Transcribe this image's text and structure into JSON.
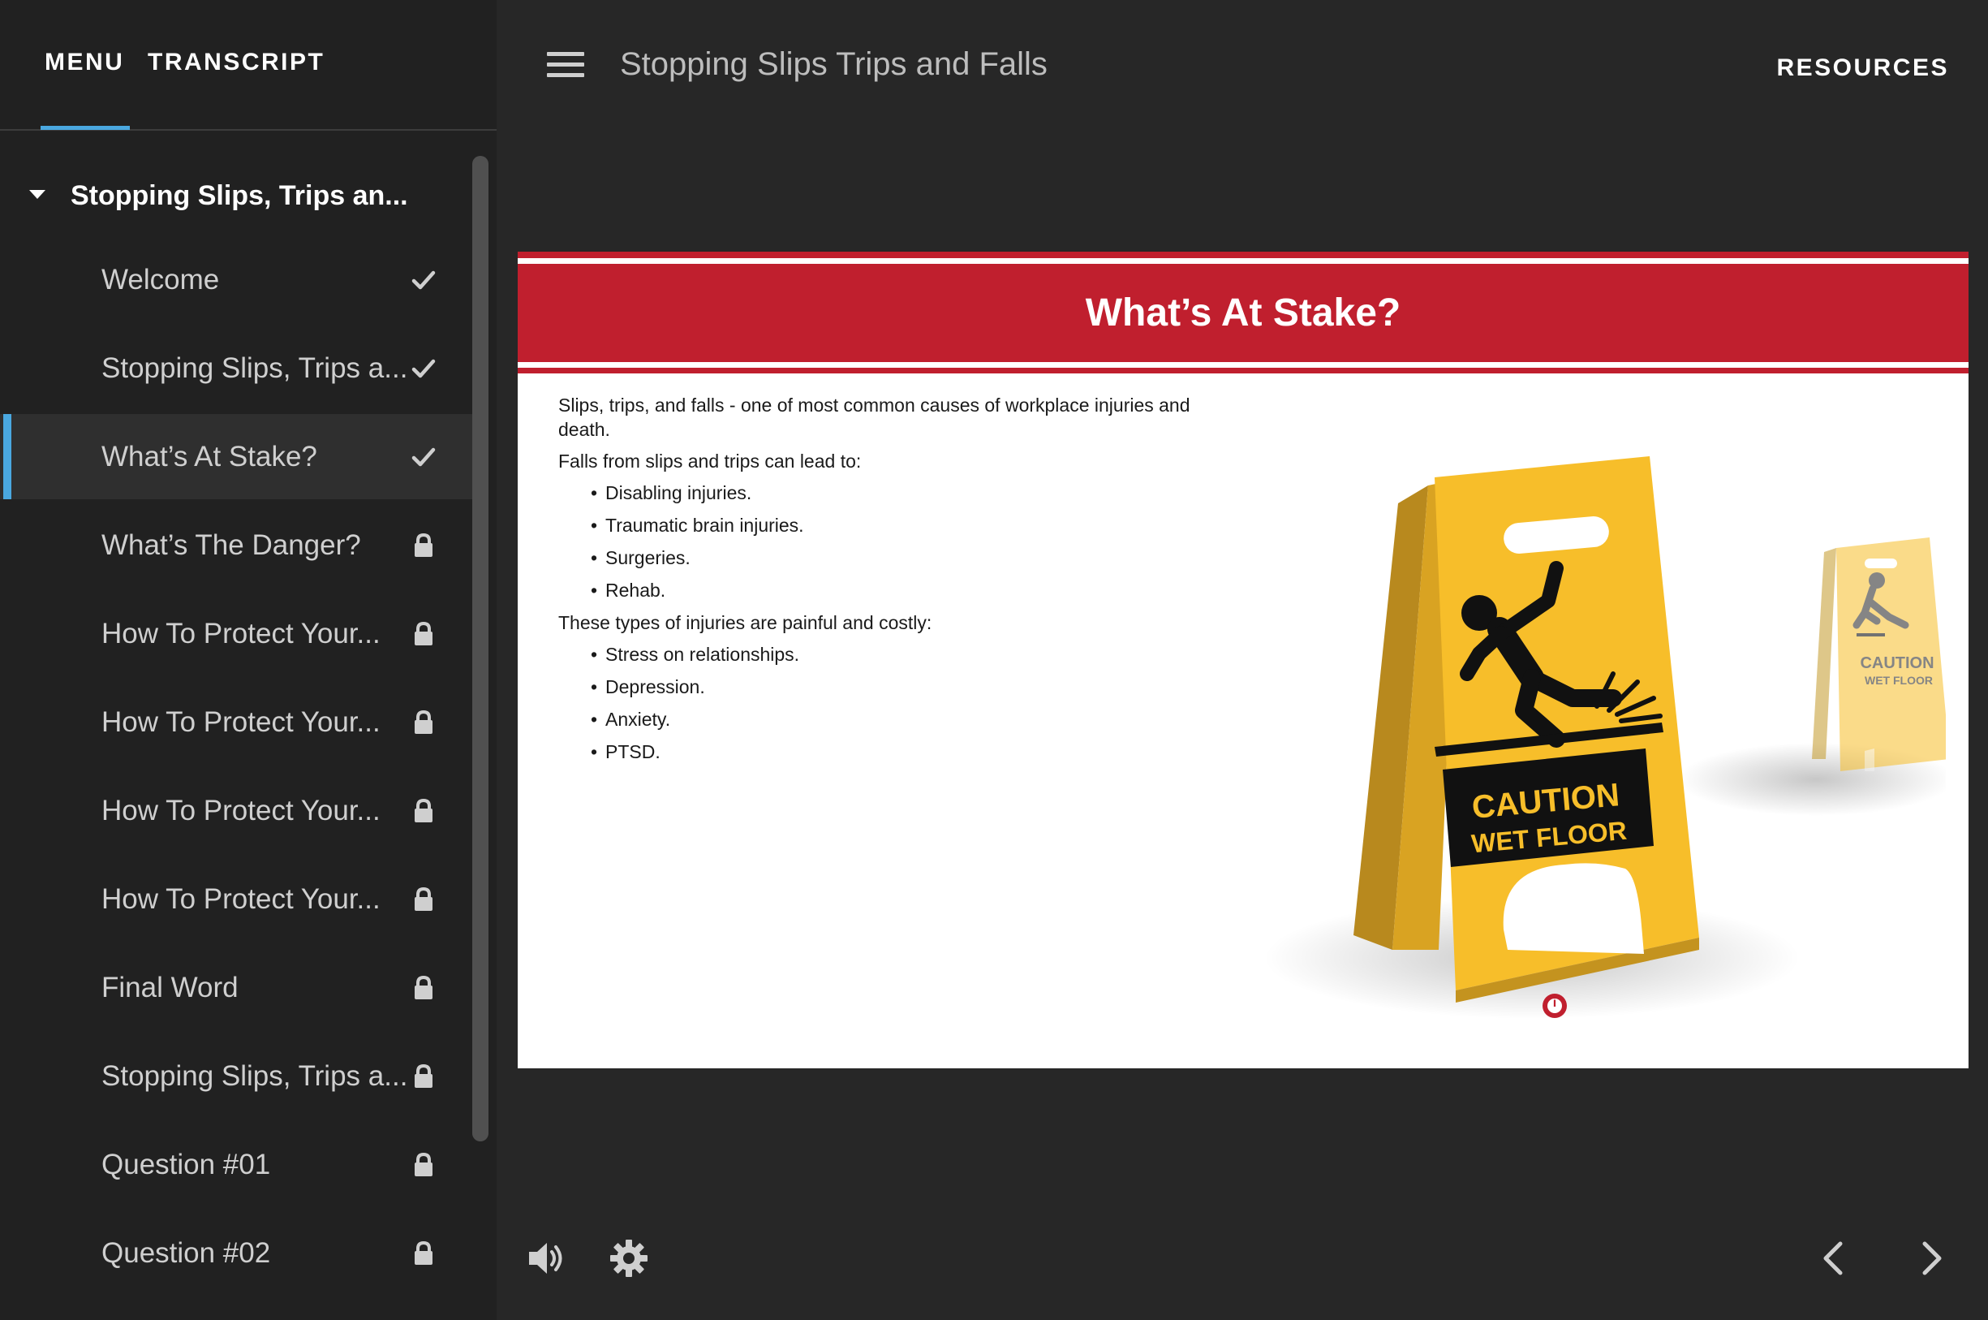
{
  "sidebar": {
    "tabs": {
      "menu": "MENU",
      "transcript": "TRANSCRIPT"
    },
    "course_title": "Stopping Slips, Trips an...",
    "items": [
      {
        "label": "Welcome",
        "status": "completed"
      },
      {
        "label": "Stopping Slips, Trips a...",
        "status": "completed"
      },
      {
        "label": "What’s At Stake?",
        "status": "completed",
        "active": true
      },
      {
        "label": "What’s The Danger?",
        "status": "locked"
      },
      {
        "label": "How To Protect Your...",
        "status": "locked"
      },
      {
        "label": "How To Protect Your...",
        "status": "locked"
      },
      {
        "label": "How To Protect Your...",
        "status": "locked"
      },
      {
        "label": "How To Protect Your...",
        "status": "locked"
      },
      {
        "label": "Final Word",
        "status": "locked"
      },
      {
        "label": "Stopping Slips, Trips a...",
        "status": "locked"
      },
      {
        "label": "Question #01",
        "status": "locked"
      },
      {
        "label": "Question #02",
        "status": "locked"
      }
    ]
  },
  "topbar": {
    "course_name": "Stopping Slips Trips and Falls",
    "resources_label": "RESOURCES"
  },
  "slide": {
    "title": "What’s At Stake?",
    "intro": "Slips, trips, and falls - one of most common causes of workplace injuries and death.",
    "lead_in_1": "Falls from slips and trips can lead to:",
    "list_1": [
      "Disabling injuries.",
      "Traumatic brain injuries.",
      "Surgeries.",
      "Rehab."
    ],
    "lead_in_2": "These types of injuries are painful and costly:",
    "list_2": [
      "Stress on relationships.",
      "Depression.",
      "Anxiety.",
      "PTSD."
    ],
    "sign_text_line1": "CAUTION",
    "sign_text_line2": "WET FLOOR",
    "info_marker": "i"
  },
  "colors": {
    "accent": "#4aa8e0",
    "banner_red": "#c01f2e",
    "sign_yellow": "#f7be2a",
    "background": "#272727",
    "sidebar_bg": "#212121"
  },
  "icons": {
    "hamburger": "menu-icon",
    "completed": "checkmark-icon",
    "locked": "lock-icon",
    "volume": "volume-icon",
    "settings": "gear-icon",
    "prev": "chevron-left-icon",
    "next": "chevron-right-icon"
  }
}
